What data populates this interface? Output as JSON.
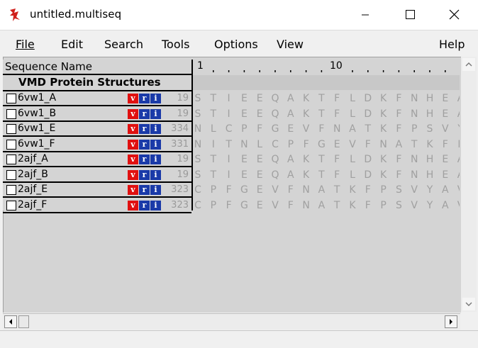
{
  "window": {
    "title": "untitled.multiseq"
  },
  "menu": {
    "file": "File",
    "edit": "Edit",
    "search": "Search",
    "tools": "Tools",
    "options": "Options",
    "view": "View",
    "help": "Help"
  },
  "header": {
    "sequence_name": "Sequence Name",
    "ruler_start": "1",
    "ruler_ten": "10"
  },
  "group": {
    "label": "VMD Protein Structures"
  },
  "badges": {
    "v": "v",
    "r": "r",
    "i": "i"
  },
  "rows": [
    {
      "name": "6vw1_A",
      "length": "19",
      "residues": [
        "S",
        "T",
        "I",
        "E",
        "E",
        "Q",
        "A",
        "K",
        "T",
        "F",
        "L",
        "D",
        "K",
        "F",
        "N",
        "H",
        "E",
        "A"
      ]
    },
    {
      "name": "6vw1_B",
      "length": "19",
      "residues": [
        "S",
        "T",
        "I",
        "E",
        "E",
        "Q",
        "A",
        "K",
        "T",
        "F",
        "L",
        "D",
        "K",
        "F",
        "N",
        "H",
        "E",
        "A"
      ]
    },
    {
      "name": "6vw1_E",
      "length": "334",
      "residues": [
        "N",
        "L",
        "C",
        "P",
        "F",
        "G",
        "E",
        "V",
        "F",
        "N",
        "A",
        "T",
        "K",
        "F",
        "P",
        "S",
        "V",
        "Y"
      ]
    },
    {
      "name": "6vw1_F",
      "length": "331",
      "residues": [
        "N",
        "I",
        "T",
        "N",
        "L",
        "C",
        "P",
        "F",
        "G",
        "E",
        "V",
        "F",
        "N",
        "A",
        "T",
        "K",
        "F",
        "P"
      ]
    },
    {
      "name": "2ajf_A",
      "length": "19",
      "residues": [
        "S",
        "T",
        "I",
        "E",
        "E",
        "Q",
        "A",
        "K",
        "T",
        "F",
        "L",
        "D",
        "K",
        "F",
        "N",
        "H",
        "E",
        "A"
      ]
    },
    {
      "name": "2ajf_B",
      "length": "19",
      "residues": [
        "S",
        "T",
        "I",
        "E",
        "E",
        "Q",
        "A",
        "K",
        "T",
        "F",
        "L",
        "D",
        "K",
        "F",
        "N",
        "H",
        "E",
        "A"
      ]
    },
    {
      "name": "2ajf_E",
      "length": "323",
      "residues": [
        "C",
        "P",
        "F",
        "G",
        "E",
        "V",
        "F",
        "N",
        "A",
        "T",
        "K",
        "F",
        "P",
        "S",
        "V",
        "Y",
        "A",
        "V"
      ]
    },
    {
      "name": "2ajf_F",
      "length": "323",
      "residues": [
        "C",
        "P",
        "F",
        "G",
        "E",
        "V",
        "F",
        "N",
        "A",
        "T",
        "K",
        "F",
        "P",
        "S",
        "V",
        "Y",
        "A",
        "V"
      ]
    }
  ],
  "icons": {
    "app": "tk-feather-icon",
    "minimize": "minimize-icon",
    "maximize": "maximize-icon",
    "close": "close-icon",
    "scroll_up": "arrow-up-icon",
    "scroll_down": "arrow-down-icon",
    "scroll_left": "arrow-left-icon",
    "scroll_right": "arrow-right-icon"
  },
  "colors": {
    "badge_v": "#e01010",
    "badge_ri": "#1a3aa8",
    "residue_text": "#a0a0a0",
    "panel_bg": "#d4d4d4"
  }
}
